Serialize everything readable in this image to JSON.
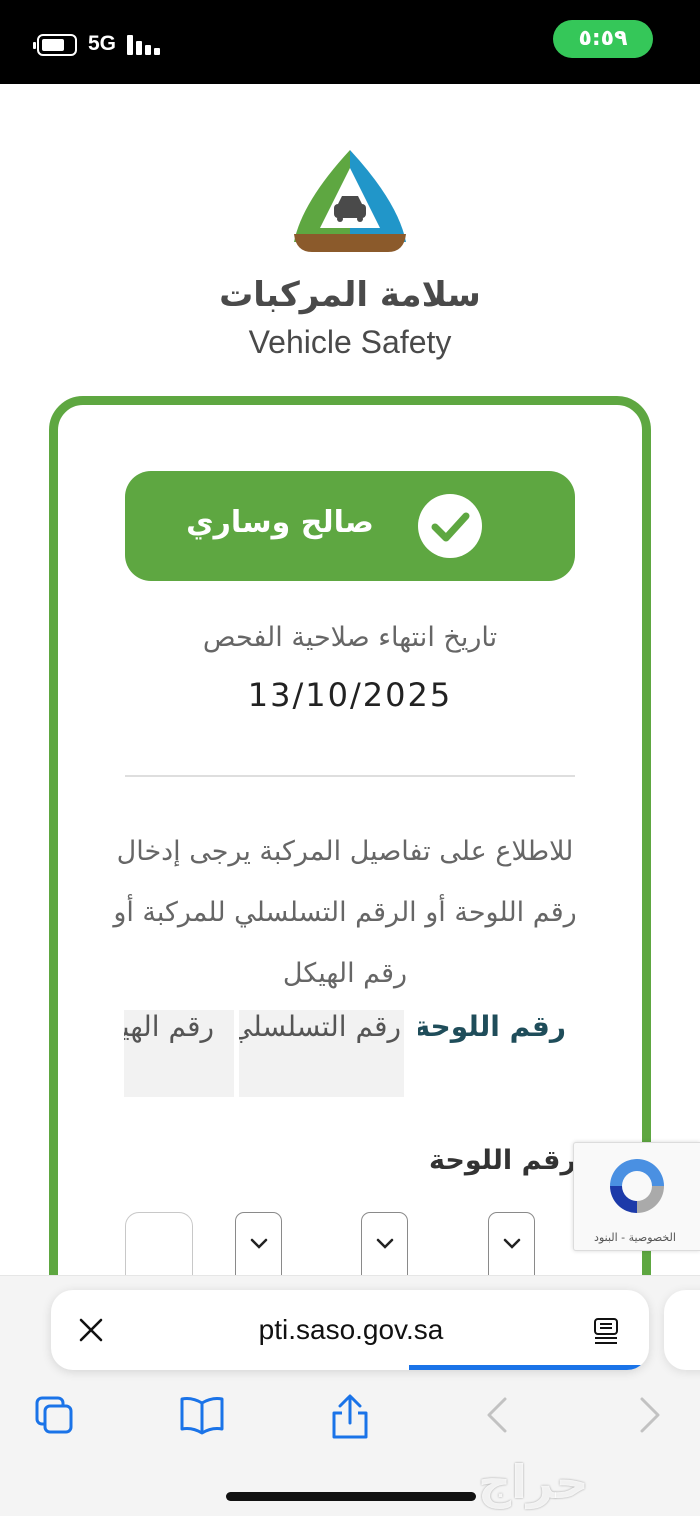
{
  "status_bar": {
    "network": "5G",
    "time": "٥:٥٩"
  },
  "brand": {
    "name_ar": "سلامة المركبات",
    "name_en": "Vehicle Safety"
  },
  "result": {
    "status": "صالح وساري",
    "expiry_label": "تاريخ انتهاء صلاحية الفحص",
    "expiry_date": "13/10/2025"
  },
  "instructions": "للاطلاع على تفاصيل المركبة يرجى إدخال رقم اللوحة أو الرقم التسلسلي للمركبة أو رقم الهيكل",
  "tabs": [
    "رقم اللوحة",
    "رقم التسلسلي",
    "رقم الهيكل"
  ],
  "plate": {
    "label": "رقم اللوحة"
  },
  "recaptcha": {
    "links": "الخصوصية - البنود"
  },
  "browser": {
    "url": "pti.saso.gov.sa"
  },
  "watermark": "حراج",
  "colors": {
    "brand_green": "#5ea741",
    "status_pill": "#35c759",
    "accent_blue": "#1a73e8",
    "logo_blue": "#2196c9",
    "logo_brown": "#8b5a2b"
  },
  "icons": [
    "battery-icon",
    "signal-icon",
    "vehicle-safety-logo",
    "check-icon",
    "chevron-down-icon",
    "recaptcha-icon",
    "close-icon",
    "reader-icon",
    "tabs-icon",
    "bookmarks-icon",
    "share-icon",
    "back-icon",
    "forward-icon"
  ]
}
